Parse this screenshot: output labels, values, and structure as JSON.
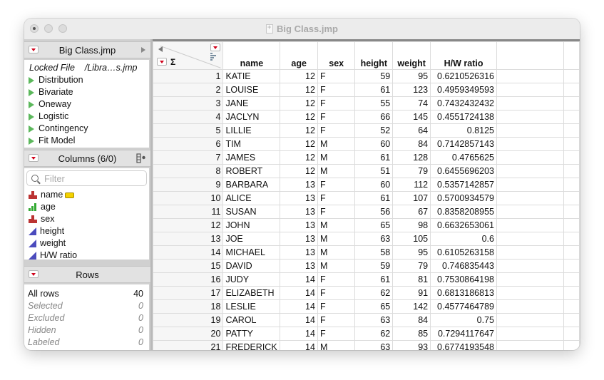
{
  "window": {
    "title": "Big Class.jmp"
  },
  "table_panel": {
    "title": "Big Class.jmp",
    "locked_label": "Locked File",
    "locked_path": "/Libra…s.jmp",
    "scripts": [
      "Distribution",
      "Bivariate",
      "Oneway",
      "Logistic",
      "Contingency",
      "Fit Model"
    ]
  },
  "columns_panel": {
    "title": "Columns (6/0)",
    "filter_placeholder": "Filter",
    "columns": [
      {
        "name": "name",
        "type": "nominal",
        "labeled": true
      },
      {
        "name": "age",
        "type": "ordinal"
      },
      {
        "name": "sex",
        "type": "nominal"
      },
      {
        "name": "height",
        "type": "continuous"
      },
      {
        "name": "weight",
        "type": "continuous"
      },
      {
        "name": "H/W ratio",
        "type": "continuous"
      }
    ]
  },
  "rows_panel": {
    "title": "Rows",
    "items": [
      {
        "label": "All rows",
        "value": "40"
      },
      {
        "label": "Selected",
        "value": "0"
      },
      {
        "label": "Excluded",
        "value": "0"
      },
      {
        "label": "Hidden",
        "value": "0"
      },
      {
        "label": "Labeled",
        "value": "0"
      }
    ]
  },
  "grid": {
    "headers": [
      "name",
      "age",
      "sex",
      "height",
      "weight",
      "H/W ratio"
    ],
    "rows": [
      [
        "1",
        "KATIE",
        "12",
        "F",
        "59",
        "95",
        "0.6210526316"
      ],
      [
        "2",
        "LOUISE",
        "12",
        "F",
        "61",
        "123",
        "0.4959349593"
      ],
      [
        "3",
        "JANE",
        "12",
        "F",
        "55",
        "74",
        "0.7432432432"
      ],
      [
        "4",
        "JACLYN",
        "12",
        "F",
        "66",
        "145",
        "0.4551724138"
      ],
      [
        "5",
        "LILLIE",
        "12",
        "F",
        "52",
        "64",
        "0.8125"
      ],
      [
        "6",
        "TIM",
        "12",
        "M",
        "60",
        "84",
        "0.7142857143"
      ],
      [
        "7",
        "JAMES",
        "12",
        "M",
        "61",
        "128",
        "0.4765625"
      ],
      [
        "8",
        "ROBERT",
        "12",
        "M",
        "51",
        "79",
        "0.6455696203"
      ],
      [
        "9",
        "BARBARA",
        "13",
        "F",
        "60",
        "112",
        "0.5357142857"
      ],
      [
        "10",
        "ALICE",
        "13",
        "F",
        "61",
        "107",
        "0.5700934579"
      ],
      [
        "11",
        "SUSAN",
        "13",
        "F",
        "56",
        "67",
        "0.8358208955"
      ],
      [
        "12",
        "JOHN",
        "13",
        "M",
        "65",
        "98",
        "0.6632653061"
      ],
      [
        "13",
        "JOE",
        "13",
        "M",
        "63",
        "105",
        "0.6"
      ],
      [
        "14",
        "MICHAEL",
        "13",
        "M",
        "58",
        "95",
        "0.6105263158"
      ],
      [
        "15",
        "DAVID",
        "13",
        "M",
        "59",
        "79",
        "0.746835443"
      ],
      [
        "16",
        "JUDY",
        "14",
        "F",
        "61",
        "81",
        "0.7530864198"
      ],
      [
        "17",
        "ELIZABETH",
        "14",
        "F",
        "62",
        "91",
        "0.6813186813"
      ],
      [
        "18",
        "LESLIE",
        "14",
        "F",
        "65",
        "142",
        "0.4577464789"
      ],
      [
        "19",
        "CAROL",
        "14",
        "F",
        "63",
        "84",
        "0.75"
      ],
      [
        "20",
        "PATTY",
        "14",
        "F",
        "62",
        "85",
        "0.7294117647"
      ],
      [
        "21",
        "FREDERICK",
        "14",
        "M",
        "63",
        "93",
        "0.6774193548"
      ]
    ]
  }
}
